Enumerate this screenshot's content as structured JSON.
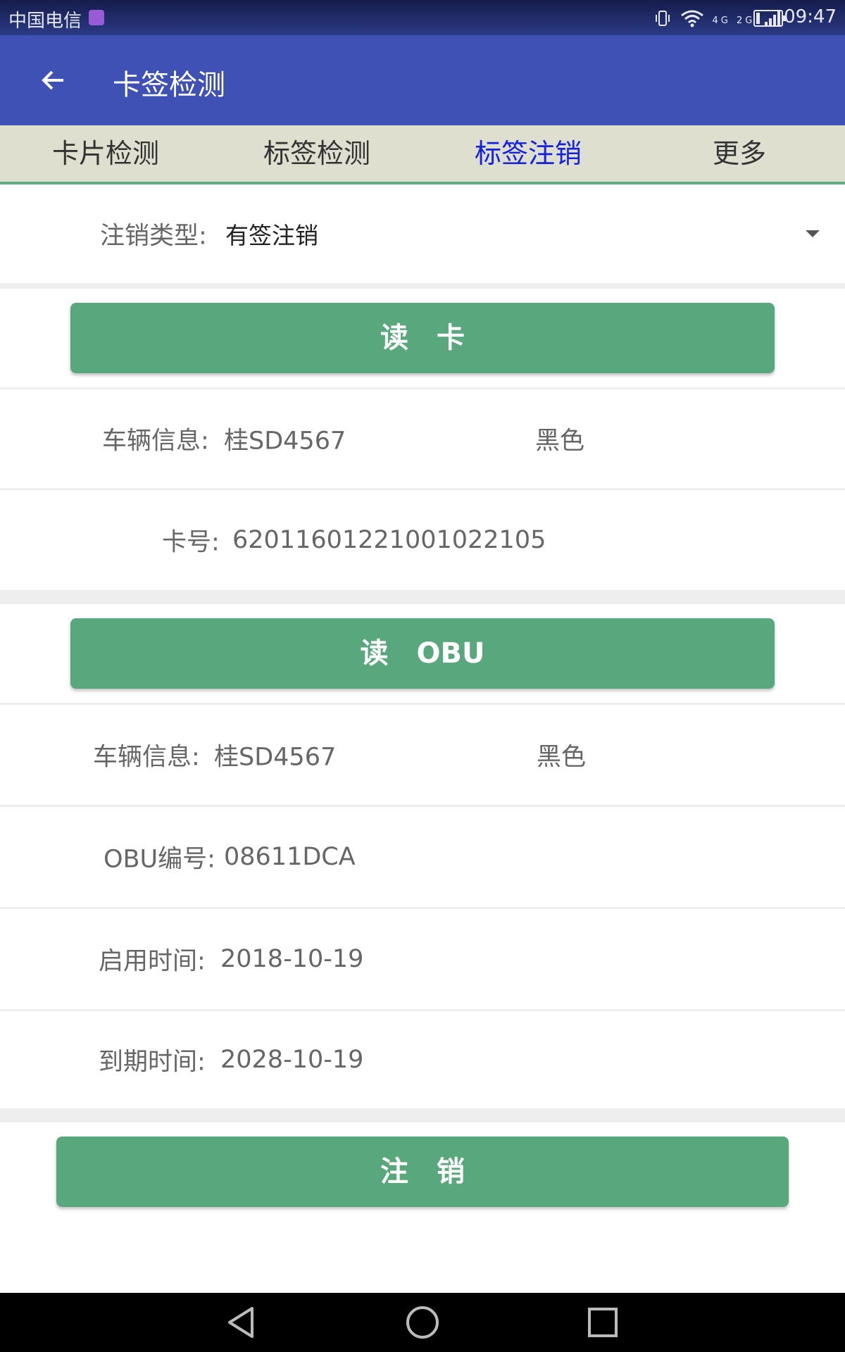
{
  "status_bar": {
    "carrier": "中国电信",
    "signal_text": "4G 2G",
    "time": "09:47",
    "battery_level": 0.15
  },
  "app_bar": {
    "title": "卡签检测",
    "back_icon": "arrow-left-icon"
  },
  "tabs": [
    {
      "label": "卡片检测",
      "active": false
    },
    {
      "label": "标签检测",
      "active": false
    },
    {
      "label": "标签注销",
      "active": true
    },
    {
      "label": "更多",
      "active": false
    }
  ],
  "cancel_type": {
    "label": "注销类型:",
    "value": "有签注销"
  },
  "read_card_button": "读　卡",
  "card_info": {
    "vehicle_label": "车辆信息:",
    "plate": "桂SD4567",
    "color": "黑色",
    "card_no_label": "卡号:",
    "card_no": "62011601221001022105"
  },
  "read_obu_button": "读　OBU",
  "obu_info": {
    "vehicle_label": "车辆信息:",
    "plate": "桂SD4567",
    "color": "黑色",
    "obu_no_label": "OBU编号:",
    "obu_no": "08611DCA",
    "start_label": "启用时间:",
    "start_date": "2018-10-19",
    "expire_label": "到期时间:",
    "expire_date": "2028-10-19"
  },
  "cancel_button": "注　销",
  "colors": {
    "app_bar": "#3f51b5",
    "tab_bar": "#dfdfd0",
    "tab_active": "#1521e0",
    "button_green": "#59a77d"
  }
}
